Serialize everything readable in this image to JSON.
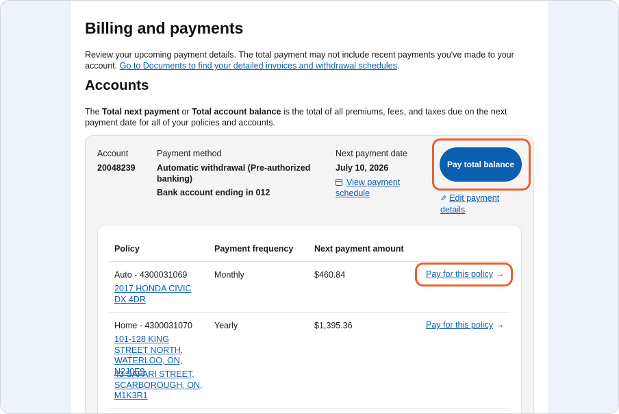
{
  "header": {
    "title": "Billing and payments",
    "intro_text": "Review your upcoming payment details. The total payment may not include recent payments you've made to your account. ",
    "documents_link": "Go to Documents to find your detailed invoices and withdrawal schedules",
    "intro_end": "."
  },
  "accounts": {
    "title": "Accounts",
    "explain_prefix": "The ",
    "explain_bold1": "Total next payment",
    "explain_or": " or ",
    "explain_bold2": "Total account balance",
    "explain_suffix": " is the total of all premiums, fees, and taxes due on the next payment date for all of your policies and accounts."
  },
  "account_card": {
    "account_label": "Account",
    "account_number": "20048239",
    "method_label": "Payment method",
    "method_value": "Automatic withdrawal (Pre-authorized banking)",
    "bank_value": "Bank account ending in 012",
    "next_date_label": "Next payment date",
    "next_date_value": "July 10, 2026",
    "view_schedule_link": "View payment schedule",
    "pay_total_button": "Pay total balance",
    "edit_payment_link": "Edit payment details"
  },
  "policy_table": {
    "headers": [
      "Policy",
      "Payment frequency",
      "Next payment amount"
    ],
    "pay_link_label": "Pay for this policy",
    "rows": [
      {
        "policy": "Auto - 4300031069",
        "assets": [
          "2017 HONDA CIVIC DX 4DR"
        ],
        "frequency": "Monthly",
        "amount": "$460.84"
      },
      {
        "policy": "Home - 4300031070",
        "assets": [
          "101-128 KING STREET NORTH, WATERLOO, ON, N2J0E9",
          "43 SAFARI STREET, SCARBOROUGH, ON, M1K3R1"
        ],
        "frequency": "Yearly",
        "amount": "$1,395.36"
      }
    ]
  },
  "colors": {
    "link": "#0b5fb0",
    "button": "#0b5fb0",
    "highlight": "#e8612f",
    "card_bg": "#f5f4f5"
  }
}
